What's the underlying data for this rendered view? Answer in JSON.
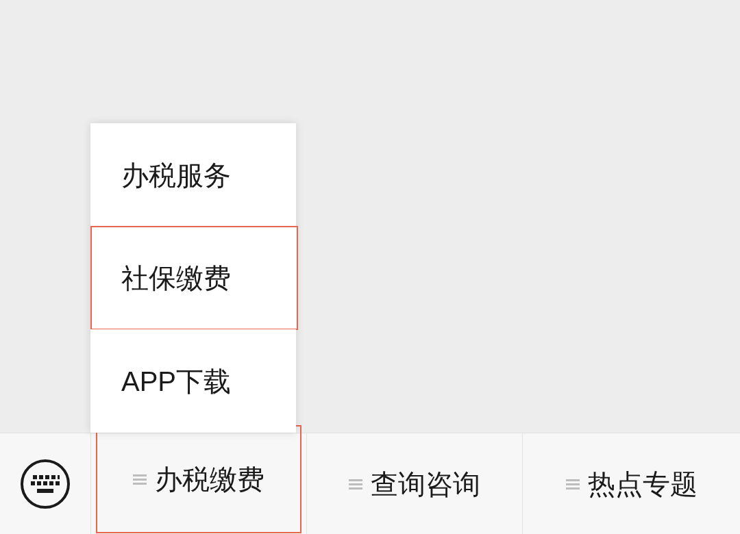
{
  "submenu": {
    "items": [
      {
        "label": "办税服务",
        "highlighted": false
      },
      {
        "label": "社保缴费",
        "highlighted": true
      },
      {
        "label": "APP下载",
        "highlighted": false
      }
    ]
  },
  "menu_bar": {
    "items": [
      {
        "label": "办税缴费",
        "highlighted": true
      },
      {
        "label": "查询咨询",
        "highlighted": false
      },
      {
        "label": "热点专题",
        "highlighted": false
      }
    ]
  }
}
